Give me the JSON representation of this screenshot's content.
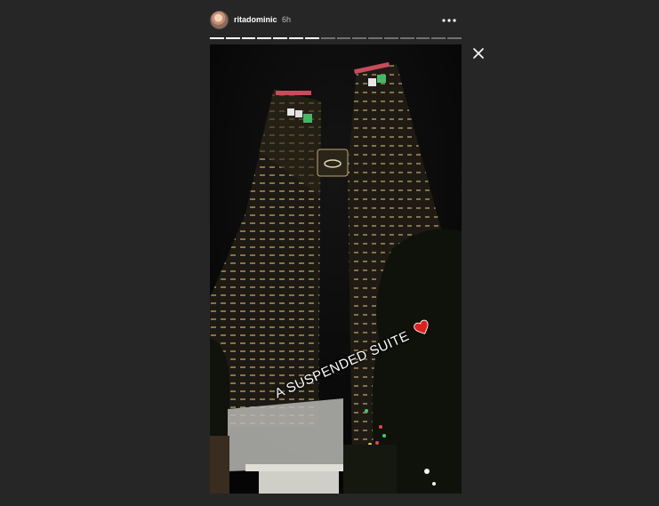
{
  "story": {
    "username": "ritadominic",
    "time_ago": "6h",
    "caption": "A SUSPENDED SUITE",
    "caption_emoji": "❤️",
    "progress": {
      "total": 16,
      "current": 7
    }
  },
  "icons": {
    "more": "more-horizontal-icon",
    "close": "close-icon",
    "heart": "heart-icon"
  },
  "colors": {
    "background": "#262626",
    "heart": "#e02020"
  }
}
